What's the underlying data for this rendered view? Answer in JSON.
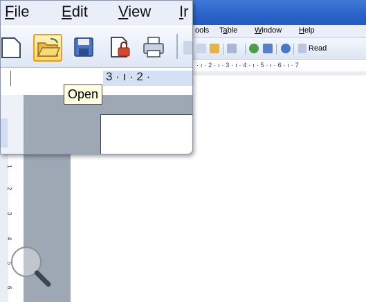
{
  "menubar": {
    "items": [
      {
        "label": "ools"
      },
      {
        "underline": "a",
        "pre": "T",
        "post": "ble"
      },
      {
        "underline": "W",
        "pre": "",
        "post": "indow"
      },
      {
        "underline": "H",
        "pre": "",
        "post": "elp"
      }
    ]
  },
  "toolbar": {
    "read_label": "Read"
  },
  "hruler": {
    "text": "· ı · 2 · ı · 3 · ı · 4 · ı · 5 · ı · 6 · ı · 7"
  },
  "vruler": {
    "ticks": [
      "1",
      "2",
      "3",
      "4",
      "5",
      "6"
    ]
  },
  "zoom": {
    "menu": [
      {
        "underline": "F",
        "post": "ile"
      },
      {
        "underline": "E",
        "post": "dit"
      },
      {
        "underline": "V",
        "post": "iew"
      },
      {
        "underline": "I",
        "post": "r"
      }
    ],
    "ruler_text": "3 · ı · 2 ·"
  },
  "tooltip": {
    "text": "Open"
  },
  "colors": {
    "titlebar": "#2a62c9",
    "open_highlight": "#ffd56a",
    "tooltip_bg": "#ffffe1",
    "gray_margin": "#9ea7b4"
  },
  "icons": [
    "new-document-icon",
    "open-folder-icon",
    "save-icon",
    "permission-icon",
    "print-icon",
    "magnifier-icon"
  ]
}
